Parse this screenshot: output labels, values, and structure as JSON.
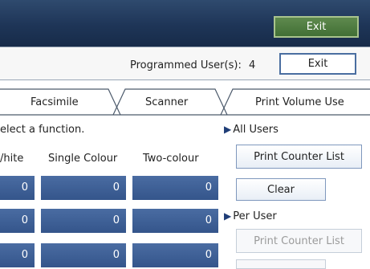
{
  "header": {
    "exit_label": "Exit"
  },
  "info": {
    "programmed_users_label": "Programmed User(s):",
    "programmed_users_count": "4",
    "exit_label": "Exit"
  },
  "tabs": [
    "Facsimile",
    "Scanner",
    "Print Volume Use"
  ],
  "prompt": "elect a function.",
  "columns": [
    "/hite",
    "Single Colour",
    "Two-colour"
  ],
  "rows": [
    [
      "0",
      "0",
      "0"
    ],
    [
      "0",
      "0",
      "0"
    ],
    [
      "0",
      "0",
      "0"
    ]
  ],
  "all_users": {
    "label": "All Users",
    "print_counter_list": "Print Counter List",
    "clear": "Clear"
  },
  "per_user": {
    "label": "Per User",
    "print_counter_list": "Print Counter List"
  },
  "colors": {
    "header_bg": "#1e3557",
    "exit_green": "#416f35",
    "cell_blue": "#3f5f95",
    "accent_border": "#4a6ea0"
  }
}
